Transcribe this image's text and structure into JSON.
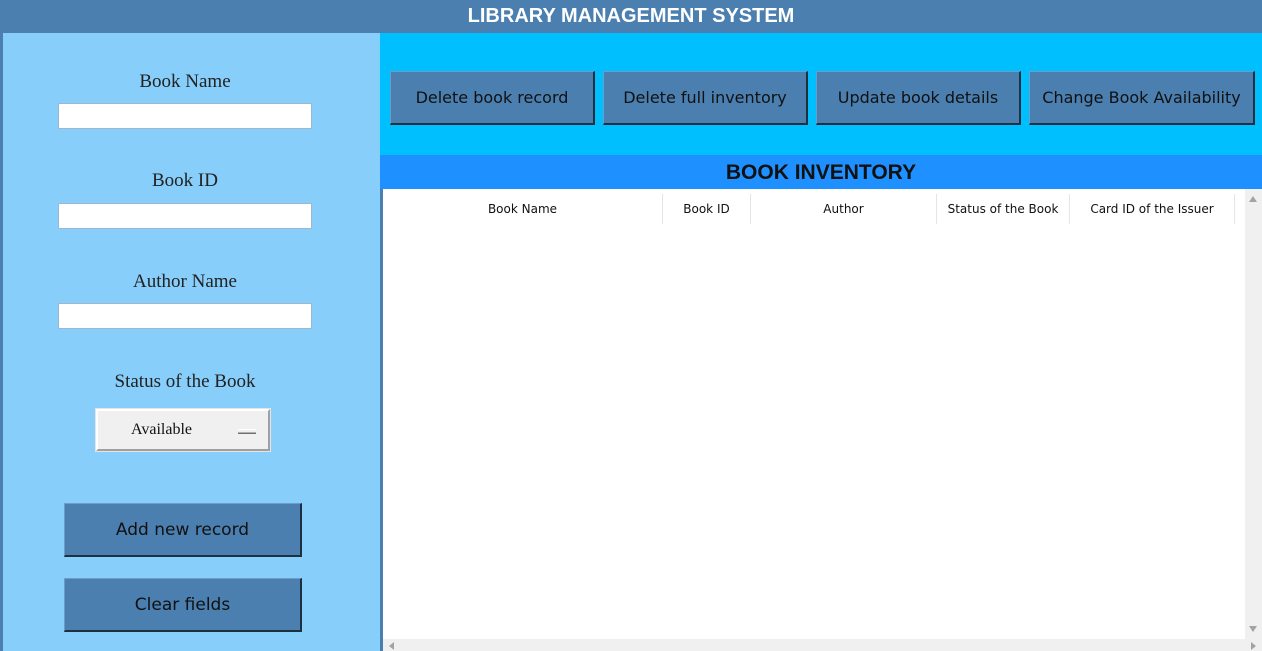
{
  "app": {
    "title": "LIBRARY MANAGEMENT SYSTEM"
  },
  "form": {
    "book_name_label": "Book Name",
    "book_name_value": "",
    "book_id_label": "Book ID",
    "book_id_value": "",
    "author_label": "Author Name",
    "author_value": "",
    "status_label": "Status of the Book",
    "status_value": "Available",
    "add_button": "Add new record",
    "clear_button": "Clear fields"
  },
  "toolbar": {
    "delete_record": "Delete book record",
    "delete_inventory": "Delete full inventory",
    "update_details": "Update book details",
    "change_availability": "Change Book Availability"
  },
  "inventory": {
    "title": "BOOK INVENTORY",
    "columns": [
      "Book Name",
      "Book ID",
      "Author",
      "Status of the Book",
      "Card ID of the Issuer"
    ],
    "rows": []
  },
  "colors": {
    "header_bg": "#4a7fb0",
    "left_panel_bg": "#87cefa",
    "toolbar_bg": "#00bfff",
    "inventory_header_bg": "#1e90ff"
  }
}
